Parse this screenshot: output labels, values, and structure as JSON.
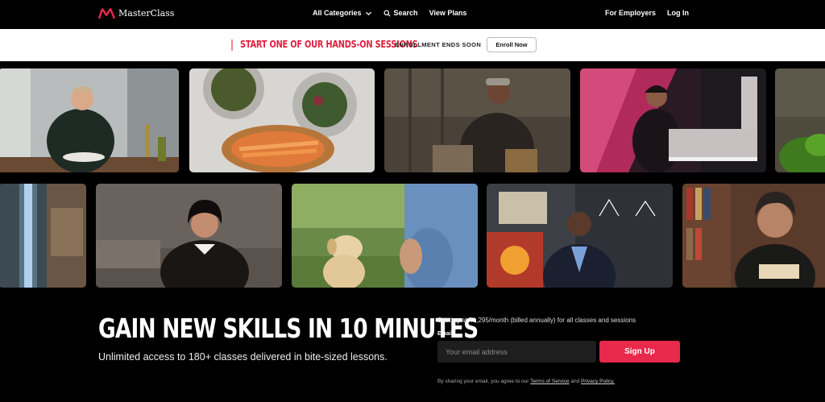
{
  "nav": {
    "logo_text": "MasterClass",
    "all_categories": "All Categories",
    "search": "Search",
    "view_plans": "View Plans",
    "for_employers": "For Employers",
    "log_in": "Log In"
  },
  "banner": {
    "headline": "START ONE OF OUR HANDS-ON SESSIONS",
    "subtext": "ENROLLMENT ENDS SOON",
    "enroll_label": "Enroll Now"
  },
  "hero": {
    "headline": "GAIN NEW SKILLS IN 10 MINUTES",
    "subline": "Unlimited access to 180+ classes delivered in bite-sized lessons."
  },
  "signup": {
    "price_line": "Starting at ₹1,295/month (billed annually) for all classes and sessions",
    "email_label": "Email*",
    "email_placeholder": "Your email address",
    "button_label": "Sign Up",
    "legal_prefix": "By sharing your email, you agree to our",
    "terms_link": "Terms of Service",
    "legal_and": "and",
    "privacy_link": "Privacy Policy."
  },
  "colors": {
    "accent": "#e8294c",
    "banner_text": "#e0203f",
    "background": "#000000"
  },
  "icons": {
    "logo": "masterclass-logo",
    "categories": "chevron-down-icon",
    "search": "search-icon"
  }
}
